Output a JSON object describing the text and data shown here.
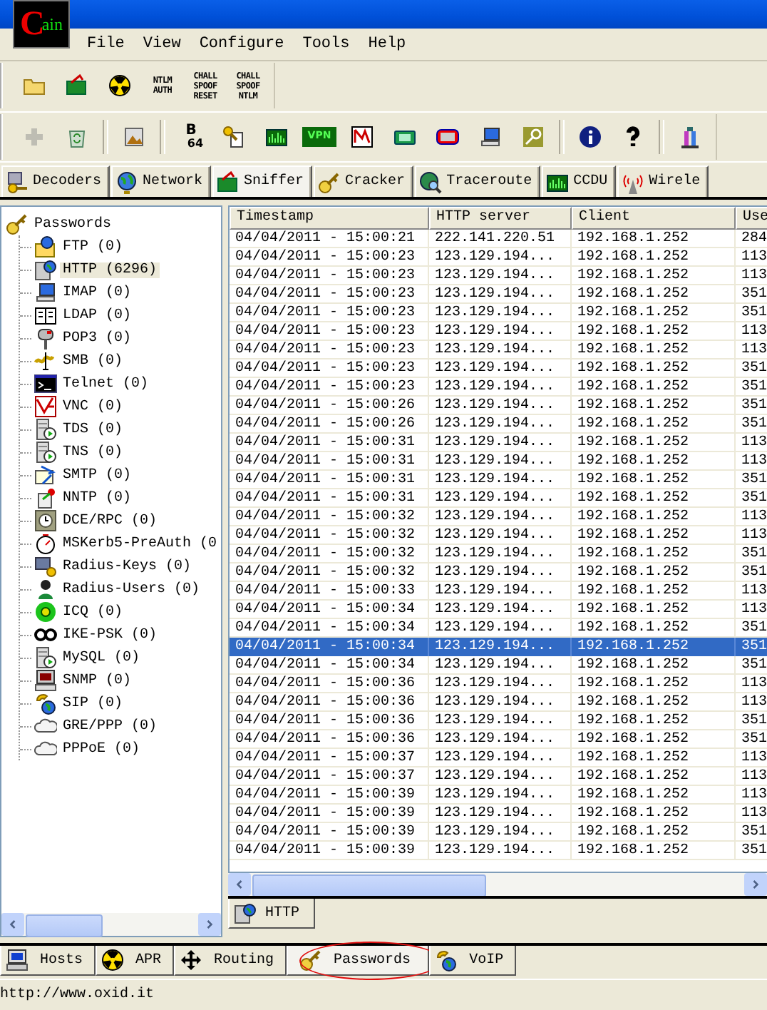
{
  "logo": {
    "initial": "C",
    "rest": "ain"
  },
  "menu": [
    "File",
    "View",
    "Configure",
    "Tools",
    "Help"
  ],
  "toolbar_1": [
    {
      "kind": "icon"
    },
    {
      "kind": "icon"
    },
    {
      "kind": "icon"
    },
    {
      "kind": "text",
      "lines": [
        "NTLM",
        "AUTH"
      ]
    },
    {
      "kind": "text",
      "lines": [
        "CHALL",
        "SPOOF",
        "RESET"
      ]
    },
    {
      "kind": "text",
      "lines": [
        "CHALL",
        "SPOOF",
        "NTLM"
      ]
    }
  ],
  "toolbar_2": [
    {
      "kind": "icon",
      "disabled": true
    },
    {
      "kind": "icon",
      "disabled": false
    },
    {
      "kind": "sep"
    },
    {
      "kind": "icon",
      "disabled": false
    },
    {
      "kind": "sep"
    },
    {
      "kind": "text",
      "lines": [
        "B",
        "64"
      ],
      "disabled": false
    },
    {
      "kind": "icon",
      "disabled": false
    },
    {
      "kind": "icon",
      "disabled": false
    },
    {
      "kind": "text",
      "lines": [
        "VPN"
      ],
      "disabled": false
    },
    {
      "kind": "icon",
      "disabled": false
    },
    {
      "kind": "icon",
      "disabled": false
    },
    {
      "kind": "icon",
      "disabled": false
    },
    {
      "kind": "icon",
      "disabled": false
    },
    {
      "kind": "icon",
      "disabled": false
    },
    {
      "kind": "sep"
    },
    {
      "kind": "icon",
      "disabled": false
    },
    {
      "kind": "icon",
      "disabled": false
    },
    {
      "kind": "sep"
    },
    {
      "kind": "icon",
      "disabled": false
    }
  ],
  "tabs": [
    {
      "label": "Decoders",
      "selected": false
    },
    {
      "label": "Network",
      "selected": false
    },
    {
      "label": "Sniffer",
      "selected": true
    },
    {
      "label": "Cracker",
      "selected": false
    },
    {
      "label": "Traceroute",
      "selected": false
    },
    {
      "label": "CCDU",
      "selected": false
    },
    {
      "label": "Wirele",
      "selected": false
    }
  ],
  "tree": {
    "label": "Passwords",
    "children": [
      {
        "label": "FTP (0)",
        "selected": false
      },
      {
        "label": "HTTP (6296)",
        "selected": true
      },
      {
        "label": "IMAP (0)",
        "selected": false
      },
      {
        "label": "LDAP (0)",
        "selected": false
      },
      {
        "label": "POP3 (0)",
        "selected": false
      },
      {
        "label": "SMB (0)",
        "selected": false
      },
      {
        "label": "Telnet (0)",
        "selected": false
      },
      {
        "label": "VNC (0)",
        "selected": false
      },
      {
        "label": "TDS (0)",
        "selected": false
      },
      {
        "label": "TNS (0)",
        "selected": false
      },
      {
        "label": "SMTP (0)",
        "selected": false
      },
      {
        "label": "NNTP (0)",
        "selected": false
      },
      {
        "label": "DCE/RPC (0)",
        "selected": false
      },
      {
        "label": "MSKerb5-PreAuth (0",
        "selected": false
      },
      {
        "label": "Radius-Keys (0)",
        "selected": false
      },
      {
        "label": "Radius-Users (0)",
        "selected": false
      },
      {
        "label": "ICQ (0)",
        "selected": false
      },
      {
        "label": "IKE-PSK (0)",
        "selected": false
      },
      {
        "label": "MySQL (0)",
        "selected": false
      },
      {
        "label": "SNMP (0)",
        "selected": false
      },
      {
        "label": "SIP (0)",
        "selected": false
      },
      {
        "label": "GRE/PPP (0)",
        "selected": false
      },
      {
        "label": "PPPoE (0)",
        "selected": false
      }
    ]
  },
  "table": {
    "columns": [
      "Timestamp",
      "HTTP server",
      "Client",
      "Use"
    ],
    "rows": [
      {
        "cells": [
          "04/04/2011 - 15:00:21",
          "222.141.220.51",
          "192.168.1.252",
          "284"
        ],
        "selected": false
      },
      {
        "cells": [
          "04/04/2011 - 15:00:23",
          "123.129.194...",
          "192.168.1.252",
          "113"
        ],
        "selected": false
      },
      {
        "cells": [
          "04/04/2011 - 15:00:23",
          "123.129.194...",
          "192.168.1.252",
          "113"
        ],
        "selected": false
      },
      {
        "cells": [
          "04/04/2011 - 15:00:23",
          "123.129.194...",
          "192.168.1.252",
          "351"
        ],
        "selected": false
      },
      {
        "cells": [
          "04/04/2011 - 15:00:23",
          "123.129.194...",
          "192.168.1.252",
          "351"
        ],
        "selected": false
      },
      {
        "cells": [
          "04/04/2011 - 15:00:23",
          "123.129.194...",
          "192.168.1.252",
          "113"
        ],
        "selected": false
      },
      {
        "cells": [
          "04/04/2011 - 15:00:23",
          "123.129.194...",
          "192.168.1.252",
          "113"
        ],
        "selected": false
      },
      {
        "cells": [
          "04/04/2011 - 15:00:23",
          "123.129.194...",
          "192.168.1.252",
          "351"
        ],
        "selected": false
      },
      {
        "cells": [
          "04/04/2011 - 15:00:23",
          "123.129.194...",
          "192.168.1.252",
          "351"
        ],
        "selected": false
      },
      {
        "cells": [
          "04/04/2011 - 15:00:26",
          "123.129.194...",
          "192.168.1.252",
          "351"
        ],
        "selected": false
      },
      {
        "cells": [
          "04/04/2011 - 15:00:26",
          "123.129.194...",
          "192.168.1.252",
          "351"
        ],
        "selected": false
      },
      {
        "cells": [
          "04/04/2011 - 15:00:31",
          "123.129.194...",
          "192.168.1.252",
          "113"
        ],
        "selected": false
      },
      {
        "cells": [
          "04/04/2011 - 15:00:31",
          "123.129.194...",
          "192.168.1.252",
          "113"
        ],
        "selected": false
      },
      {
        "cells": [
          "04/04/2011 - 15:00:31",
          "123.129.194...",
          "192.168.1.252",
          "351"
        ],
        "selected": false
      },
      {
        "cells": [
          "04/04/2011 - 15:00:31",
          "123.129.194...",
          "192.168.1.252",
          "351"
        ],
        "selected": false
      },
      {
        "cells": [
          "04/04/2011 - 15:00:32",
          "123.129.194...",
          "192.168.1.252",
          "113"
        ],
        "selected": false
      },
      {
        "cells": [
          "04/04/2011 - 15:00:32",
          "123.129.194...",
          "192.168.1.252",
          "113"
        ],
        "selected": false
      },
      {
        "cells": [
          "04/04/2011 - 15:00:32",
          "123.129.194...",
          "192.168.1.252",
          "351"
        ],
        "selected": false
      },
      {
        "cells": [
          "04/04/2011 - 15:00:32",
          "123.129.194...",
          "192.168.1.252",
          "351"
        ],
        "selected": false
      },
      {
        "cells": [
          "04/04/2011 - 15:00:33",
          "123.129.194...",
          "192.168.1.252",
          "113"
        ],
        "selected": false
      },
      {
        "cells": [
          "04/04/2011 - 15:00:34",
          "123.129.194...",
          "192.168.1.252",
          "113"
        ],
        "selected": false
      },
      {
        "cells": [
          "04/04/2011 - 15:00:34",
          "123.129.194...",
          "192.168.1.252",
          "351"
        ],
        "selected": false
      },
      {
        "cells": [
          "04/04/2011 - 15:00:34",
          "123.129.194...",
          "192.168.1.252",
          "351"
        ],
        "selected": true
      },
      {
        "cells": [
          "04/04/2011 - 15:00:34",
          "123.129.194...",
          "192.168.1.252",
          "351"
        ],
        "selected": false
      },
      {
        "cells": [
          "04/04/2011 - 15:00:36",
          "123.129.194...",
          "192.168.1.252",
          "113"
        ],
        "selected": false
      },
      {
        "cells": [
          "04/04/2011 - 15:00:36",
          "123.129.194...",
          "192.168.1.252",
          "113"
        ],
        "selected": false
      },
      {
        "cells": [
          "04/04/2011 - 15:00:36",
          "123.129.194...",
          "192.168.1.252",
          "351"
        ],
        "selected": false
      },
      {
        "cells": [
          "04/04/2011 - 15:00:36",
          "123.129.194...",
          "192.168.1.252",
          "351"
        ],
        "selected": false
      },
      {
        "cells": [
          "04/04/2011 - 15:00:37",
          "123.129.194...",
          "192.168.1.252",
          "113"
        ],
        "selected": false
      },
      {
        "cells": [
          "04/04/2011 - 15:00:37",
          "123.129.194...",
          "192.168.1.252",
          "113"
        ],
        "selected": false
      },
      {
        "cells": [
          "04/04/2011 - 15:00:39",
          "123.129.194...",
          "192.168.1.252",
          "113"
        ],
        "selected": false
      },
      {
        "cells": [
          "04/04/2011 - 15:00:39",
          "123.129.194...",
          "192.168.1.252",
          "113"
        ],
        "selected": false
      },
      {
        "cells": [
          "04/04/2011 - 15:00:39",
          "123.129.194...",
          "192.168.1.252",
          "351"
        ],
        "selected": false
      },
      {
        "cells": [
          "04/04/2011 - 15:00:39",
          "123.129.194...",
          "192.168.1.252",
          "351"
        ],
        "selected": false
      }
    ]
  },
  "sub_tabs": [
    {
      "label": "HTTP",
      "selected": true
    }
  ],
  "bottom_tabs": [
    {
      "label": "Hosts",
      "selected": false,
      "circled": false
    },
    {
      "label": "APR",
      "selected": false,
      "circled": false
    },
    {
      "label": "Routing",
      "selected": false,
      "circled": false
    },
    {
      "label": "Passwords",
      "selected": true,
      "circled": true
    },
    {
      "label": "VoIP",
      "selected": false,
      "circled": false
    }
  ],
  "status_bar": "http://www.oxid.it"
}
